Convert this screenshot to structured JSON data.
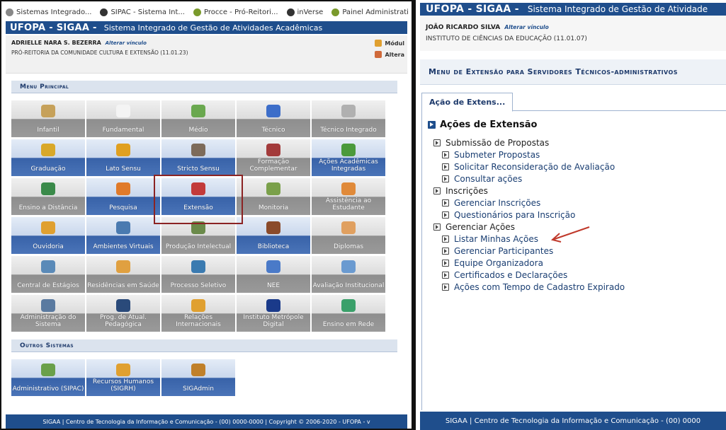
{
  "left": {
    "bookmarks": [
      {
        "label": "Sistemas Integrado...",
        "icon": "page-icon",
        "color": "#888888"
      },
      {
        "label": "SIPAC - Sistema Int...",
        "icon": "web-icon",
        "color": "#333333"
      },
      {
        "label": "Procce - Pró-Reitori...",
        "icon": "leaf-icon",
        "color": "#7a9a2c"
      },
      {
        "label": "inVerse",
        "icon": "monitor-icon",
        "color": "#333333"
      },
      {
        "label": "Painel Administrati",
        "icon": "leaf-icon",
        "color": "#7a9a2c"
      }
    ],
    "app_title": "UFOPA - SIGAA -",
    "app_subtitle": "Sistema Integrado de Gestão de Atividades Acadêmicas",
    "user_name": "ADRIELLE NARA S. BEZERRA",
    "alterar_vinculo": "Alterar vínculo",
    "unit": "PRÓ-REITORIA DA COMUNIDADE CULTURA E EXTENSÃO (11.01.23)",
    "side_links": [
      "Módul",
      "Altera"
    ],
    "menu_principal": "Menu Principal",
    "outros_sistemas": "Outros Sistemas",
    "tiles": [
      {
        "label": "Infantil",
        "style": "gray",
        "icon": "pencil-icon",
        "color": "#c6a15a"
      },
      {
        "label": "Fundamental",
        "style": "gray",
        "icon": "notebook-icon",
        "color": "#f4f4f4"
      },
      {
        "label": "Médio",
        "style": "gray",
        "icon": "crayon-icon",
        "color": "#6aa84f"
      },
      {
        "label": "Técnico",
        "style": "gray",
        "icon": "book-blue-icon",
        "color": "#3d6ec9"
      },
      {
        "label": "Técnico Integrado",
        "style": "gray",
        "icon": "tools-icon",
        "color": "#b0b0b0"
      },
      {
        "label": "Graduação",
        "style": "blue",
        "icon": "books-icon",
        "color": "#d9a829"
      },
      {
        "label": "Lato Sensu",
        "style": "blue",
        "icon": "folder-icon",
        "color": "#e0a020"
      },
      {
        "label": "Stricto Sensu",
        "style": "blue",
        "icon": "briefcase-icon",
        "color": "#7d6b5a"
      },
      {
        "label": "Formação Complementar",
        "style": "gray",
        "icon": "book-red-icon",
        "color": "#a33b3b"
      },
      {
        "label": "Ações Acadêmicas Integradas",
        "style": "blue",
        "icon": "puzzle-icon",
        "color": "#4b9a3c"
      },
      {
        "label": "Ensino a Distância",
        "style": "gray",
        "icon": "globe-icon",
        "color": "#3a8a4a"
      },
      {
        "label": "Pesquisa",
        "style": "blue",
        "icon": "flask-icon",
        "color": "#e07a2a"
      },
      {
        "label": "Extensão",
        "style": "blue",
        "icon": "gift-icon",
        "color": "#c23a3a"
      },
      {
        "label": "Monitoria",
        "style": "gray",
        "icon": "board-icon",
        "color": "#7aa04a"
      },
      {
        "label": "Assistência ao Estudante",
        "style": "gray",
        "icon": "person-icon",
        "color": "#e08a3a"
      },
      {
        "label": "Ouvidoria",
        "style": "blue",
        "icon": "user-icon",
        "color": "#e0a030"
      },
      {
        "label": "Ambientes Virtuais",
        "style": "blue",
        "icon": "network-icon",
        "color": "#4a7ab0"
      },
      {
        "label": "Produção Intelectual",
        "style": "gray",
        "icon": "pen-icon",
        "color": "#6a8a4a"
      },
      {
        "label": "Biblioteca",
        "style": "blue",
        "icon": "book-stack-icon",
        "color": "#8a4a2a"
      },
      {
        "label": "Diplomas",
        "style": "gray",
        "icon": "diploma-icon",
        "color": "#e0a060"
      },
      {
        "label": "Central de Estágios",
        "style": "gray",
        "icon": "badge-icon",
        "color": "#5a8ab8"
      },
      {
        "label": "Residências em Saúde",
        "style": "gray",
        "icon": "doctor-icon",
        "color": "#e0a040"
      },
      {
        "label": "Processo Seletivo",
        "style": "gray",
        "icon": "spinner-icon",
        "color": "#3a7ab0"
      },
      {
        "label": "NEE",
        "style": "gray",
        "icon": "wheelchair-icon",
        "color": "#4a7ac8"
      },
      {
        "label": "Avaliação Institucional",
        "style": "gray",
        "icon": "document-icon",
        "color": "#6a9ad0"
      },
      {
        "label": "Administração do Sistema",
        "style": "gray",
        "icon": "gear-icon",
        "color": "#5a7aa0"
      },
      {
        "label": "Prog. de Atual. Pedagógica",
        "style": "gray",
        "icon": "presentation-icon",
        "color": "#2a4a7a"
      },
      {
        "label": "Relações Internacionais",
        "style": "gray",
        "icon": "plane-icon",
        "color": "#e0a030"
      },
      {
        "label": "Instituto Metrópole Digital",
        "style": "gray",
        "icon": "imd-logo-icon",
        "color": "#1a3a8a"
      },
      {
        "label": "Ensino em Rede",
        "style": "gray",
        "icon": "network-globe-icon",
        "color": "#3aa06a"
      }
    ],
    "other_tiles": [
      {
        "label": "Administrativo (SIPAC)",
        "style": "blue",
        "icon": "stamp-icon",
        "color": "#6aa04a"
      },
      {
        "label": "Recursos Humanos (SIGRH)",
        "style": "blue",
        "icon": "people-icon",
        "color": "#e0a030"
      },
      {
        "label": "SIGAdmin",
        "style": "blue",
        "icon": "admin-icon",
        "color": "#c0802a"
      }
    ],
    "footer": "SIGAA | Centro de Tecnologia da Informação e Comunicação - (00) 0000-0000 | Copyright © 2006-2020 - UFOPA - v"
  },
  "right": {
    "app_title": "UFOPA - SIGAA -",
    "app_subtitle": "Sistema Integrado de Gestão de Atividade",
    "user_name": "JOÃO RICARDO SILVA",
    "alterar_vinculo": "Alterar vínculo",
    "unit": "INSTITUTO DE CIÊNCIAS DA EDUCAÇÃO (11.01.07)",
    "page_title": "Menu de Extensão para Servidores Técnicos-administrativos",
    "tab": "Ação de Extens...",
    "tree_root": "Ações de Extensão",
    "groups": [
      {
        "label": "Submissão de Propostas",
        "items": [
          "Submeter Propostas",
          "Solicitar Reconsideração de Avaliação",
          "Consultar ações"
        ]
      },
      {
        "label": "Inscrições",
        "items": [
          "Gerenciar Inscrições",
          "Questionários para Inscrição"
        ]
      },
      {
        "label": "Gerenciar Ações",
        "items": [
          "Listar Minhas Ações",
          "Gerenciar Participantes",
          "Equipe Organizadora",
          "Certificados e Declarações",
          "Ações com Tempo de Cadastro Expirado"
        ]
      }
    ],
    "footer": "SIGAA | Centro de Tecnologia da Informação e Comunicação - (00) 0000"
  },
  "colors": {
    "brand": "#1f4e8c",
    "highlight": "#8b2323",
    "arrow": "#c0392b"
  }
}
